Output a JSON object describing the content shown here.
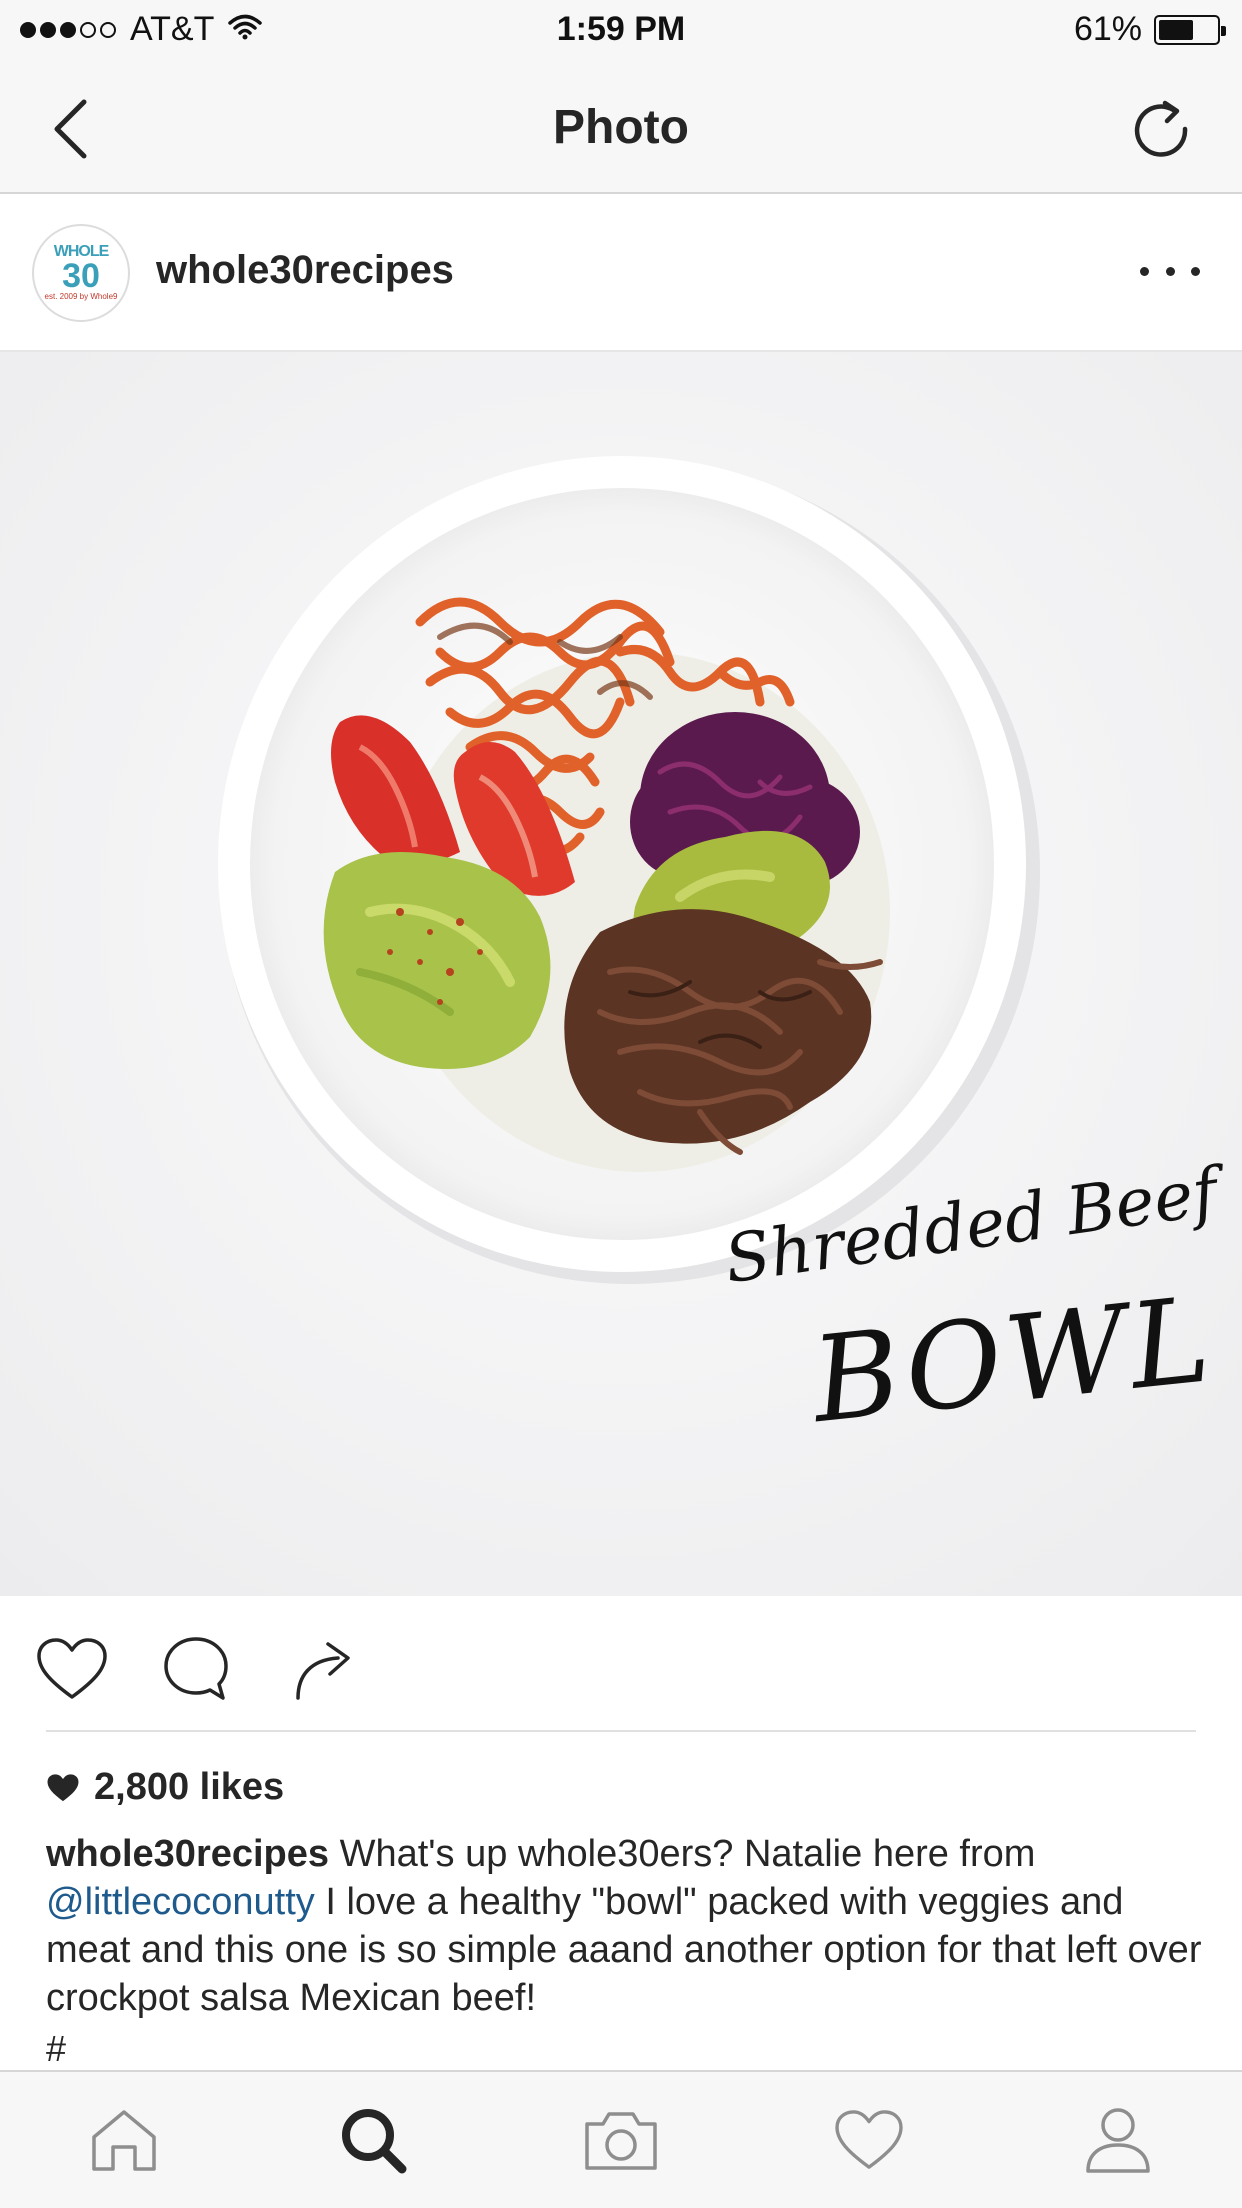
{
  "status_bar": {
    "carrier": "AT&T",
    "signal_bars_filled": 3,
    "signal_bars_total": 5,
    "time": "1:59 PM",
    "battery_percent": "61%",
    "battery_level": 0.61
  },
  "nav": {
    "title": "Photo",
    "back_icon": "chevron-left-icon",
    "refresh_icon": "refresh-icon"
  },
  "post": {
    "username": "whole30recipes",
    "avatar": {
      "top": "WHOLE",
      "number": "30",
      "sub": "est. 2009 by Whole9"
    },
    "photo": {
      "script_line": "Shredded Beef",
      "big_line": "BOWL"
    },
    "likes": "2,800 likes",
    "caption": {
      "username": "whole30recipes",
      "text_1": "What's up whole30ers? Natalie here from",
      "mention": "@littlecoconutty",
      "text_2": "I love a healthy \"bowl\" packed with veggies and meat and this one is so simple aaand another option for that left over crockpot salsa Mexican beef!"
    },
    "hashtag": "#"
  },
  "tabs": [
    "home-icon",
    "search-icon",
    "camera-icon",
    "heart-icon",
    "profile-icon"
  ],
  "colors": {
    "bar_background": "#f7f7f7",
    "text": "#262626",
    "mention": "#1e5a8c",
    "avatar_accent": "#3a9fb8"
  }
}
